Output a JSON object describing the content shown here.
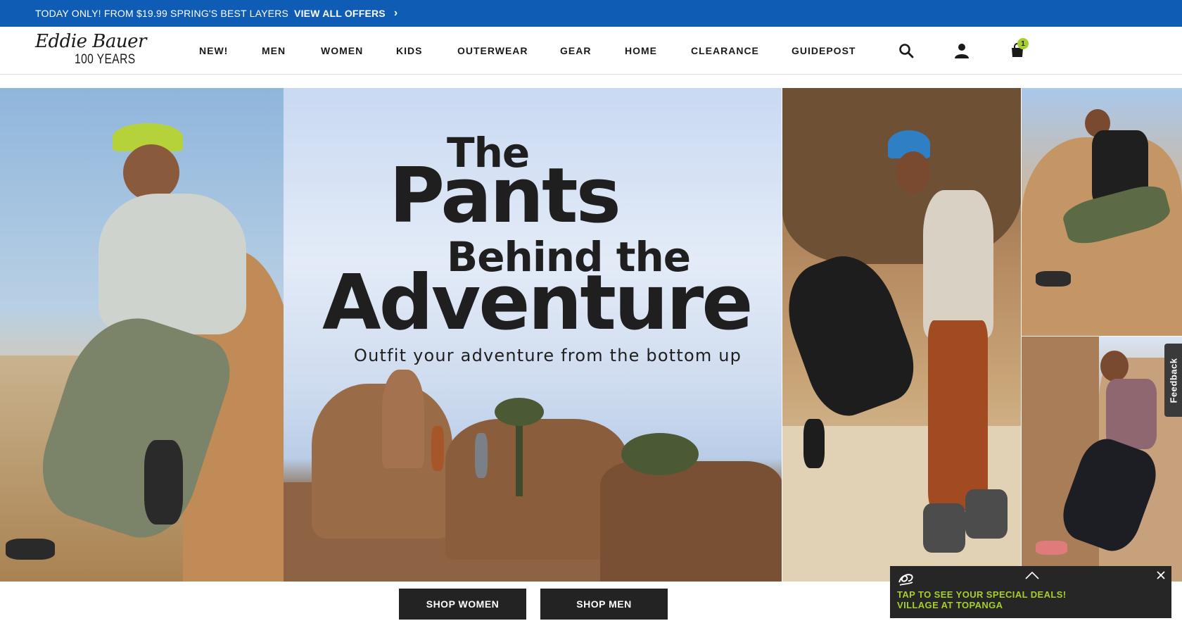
{
  "promo": {
    "message": "TODAY ONLY! FROM $19.99 SPRING'S BEST LAYERS",
    "link_label": "VIEW ALL OFFERS"
  },
  "header": {
    "logo_script": "Eddie Bauer",
    "logo_years": "100 YEARS",
    "nav": [
      "NEW!",
      "MEN",
      "WOMEN",
      "KIDS",
      "OUTERWEAR",
      "GEAR",
      "HOME",
      "CLEARANCE",
      "GUIDEPOST"
    ],
    "cart_count": "1",
    "icons": [
      "search-icon",
      "account-icon",
      "bag-icon"
    ]
  },
  "hero": {
    "line1": "The",
    "line2": "Pants",
    "line3": "Behind the",
    "line4": "Adventure",
    "subtitle": "Outfit your adventure from the bottom up"
  },
  "feedback_label": "Feedback",
  "buttons": {
    "shop_women": "SHOP WOMEN",
    "shop_men": "SHOP MEN"
  },
  "deals": {
    "line1": "TAP TO SEE YOUR SPECIAL DEALS!",
    "line2": "VILLAGE AT TOPANGA"
  },
  "colors": {
    "promo_bg": "#0f5cb5",
    "badge": "#a6cf2e",
    "button_bg": "#232323",
    "deals_text": "#a6cf2e"
  }
}
